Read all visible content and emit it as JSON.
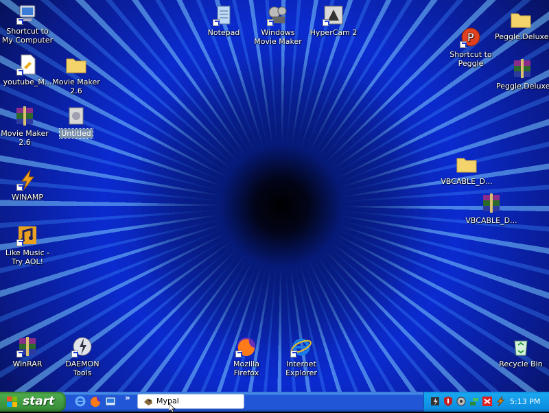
{
  "desktop": {
    "icons": {
      "my_computer": "Shortcut to My Computer",
      "youtube": "youtube_M...",
      "movie_maker_folder": "Movie Maker 2.6",
      "movie_maker_rar": "Movie Maker 2.6",
      "untitled": "Untitled",
      "winamp": "WINAMP",
      "like_music": "Like Music - Try AOL!",
      "notepad": "Notepad",
      "windows_movie_maker": "Windows Movie Maker",
      "hypercam": "HyperCam 2",
      "peggle_folder": "Peggle.Deluxe",
      "peggle_shortcut": "Shortcut to Peggle",
      "peggle_rar": "Peggle.Deluxe",
      "vbcable_folder": "VBCABLE_D...",
      "vbcable_rar": "VBCABLE_D...",
      "winrar": "WinRAR",
      "daemon_tools": "DAEMON Tools",
      "firefox": "Mozilla Firefox",
      "internet_explorer": "Internet Explorer",
      "recycle_bin": "Recycle Bin"
    }
  },
  "taskbar": {
    "start_label": "start",
    "chevron": "»",
    "task_button": "Mypal",
    "clock": "5:13 PM"
  },
  "colors": {
    "taskbar_blue": "#2156d6",
    "start_green": "#3a933a",
    "tray_blue": "#0c8ee0"
  }
}
